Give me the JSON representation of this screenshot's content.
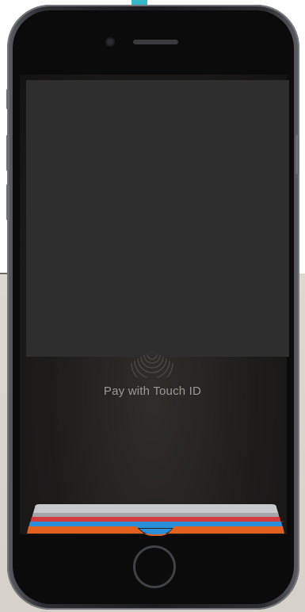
{
  "screen": {
    "pay_label": "Pay with Touch ID"
  },
  "icons": {
    "fingerprint": "fingerprint-icon",
    "home": "home-button",
    "camera": "front-camera",
    "speaker": "earpiece-speaker"
  },
  "colors": {
    "card_red": "#d23c3c",
    "card_blue": "#2b8fd8",
    "card_orange": "#e2611f",
    "card_silver": "#c7c9cc",
    "cable": "#36b8c6"
  }
}
